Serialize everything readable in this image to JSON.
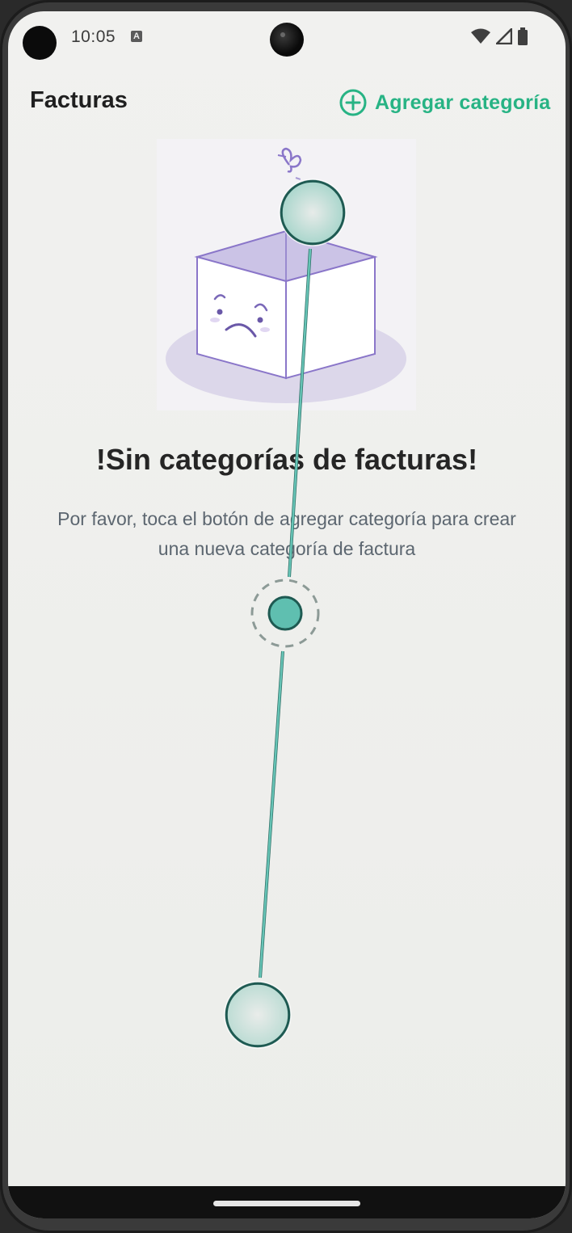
{
  "status_bar": {
    "time": "10:05",
    "notification_icon": "a-icon",
    "icons": [
      "wifi-icon",
      "signal-icon",
      "battery-icon"
    ]
  },
  "app_bar": {
    "title": "Facturas",
    "add_category_label": "Agregar categoría",
    "add_icon": "plus-circle-icon"
  },
  "empty_state": {
    "illustration": "sad-empty-box-illustration",
    "title": "!Sin categorías de facturas!",
    "description": "Por favor, toca el botón de agregar categoría para crear una nueva categoría de factura"
  },
  "colors": {
    "accent": "#27b384",
    "gesture_teal": "#5fbfb0",
    "illustration_purple": "#8a76c9"
  }
}
